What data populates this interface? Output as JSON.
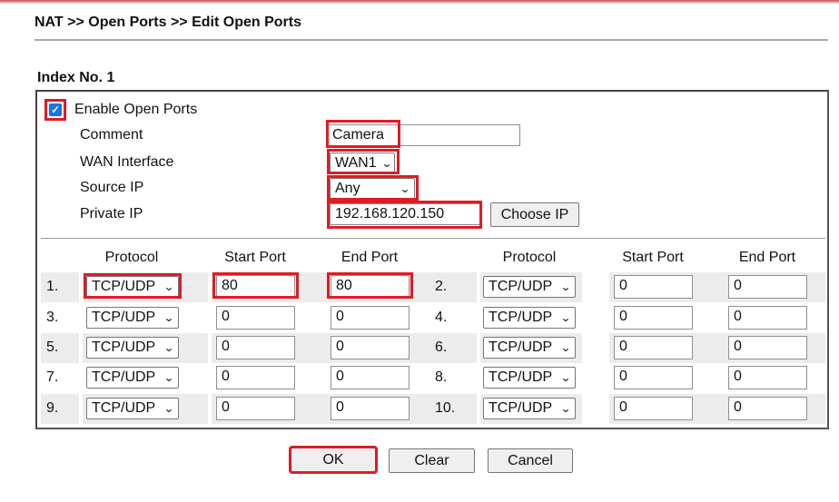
{
  "breadcrumb": "NAT >> Open Ports >> Edit Open Ports",
  "index_title": "Index No. 1",
  "form": {
    "enable": {
      "label": "Enable Open Ports",
      "checked": true
    },
    "comment": {
      "label": "Comment",
      "value": "Camera"
    },
    "wan_interface": {
      "label": "WAN Interface",
      "value": "WAN1"
    },
    "source_ip": {
      "label": "Source IP",
      "value": "Any"
    },
    "private_ip": {
      "label": "Private IP",
      "value": "192.168.120.150",
      "choose_button": "Choose IP"
    }
  },
  "ports": {
    "headers": {
      "protocol": "Protocol",
      "start_port": "Start Port",
      "end_port": "End Port"
    },
    "entries": [
      {
        "num": "1.",
        "protocol": "TCP/UDP",
        "start": "80",
        "end": "80"
      },
      {
        "num": "2.",
        "protocol": "TCP/UDP",
        "start": "0",
        "end": "0"
      },
      {
        "num": "3.",
        "protocol": "TCP/UDP",
        "start": "0",
        "end": "0"
      },
      {
        "num": "4.",
        "protocol": "TCP/UDP",
        "start": "0",
        "end": "0"
      },
      {
        "num": "5.",
        "protocol": "TCP/UDP",
        "start": "0",
        "end": "0"
      },
      {
        "num": "6.",
        "protocol": "TCP/UDP",
        "start": "0",
        "end": "0"
      },
      {
        "num": "7.",
        "protocol": "TCP/UDP",
        "start": "0",
        "end": "0"
      },
      {
        "num": "8.",
        "protocol": "TCP/UDP",
        "start": "0",
        "end": "0"
      },
      {
        "num": "9.",
        "protocol": "TCP/UDP",
        "start": "0",
        "end": "0"
      },
      {
        "num": "10.",
        "protocol": "TCP/UDP",
        "start": "0",
        "end": "0"
      }
    ]
  },
  "buttons": {
    "ok": "OK",
    "clear": "Clear",
    "cancel": "Cancel"
  },
  "icons": {
    "checkbox_check": "✓",
    "chevron": "⌄"
  },
  "colors": {
    "highlight": "#e01b24",
    "checkbox": "#1a73e8",
    "row_shade": "#ececec"
  }
}
